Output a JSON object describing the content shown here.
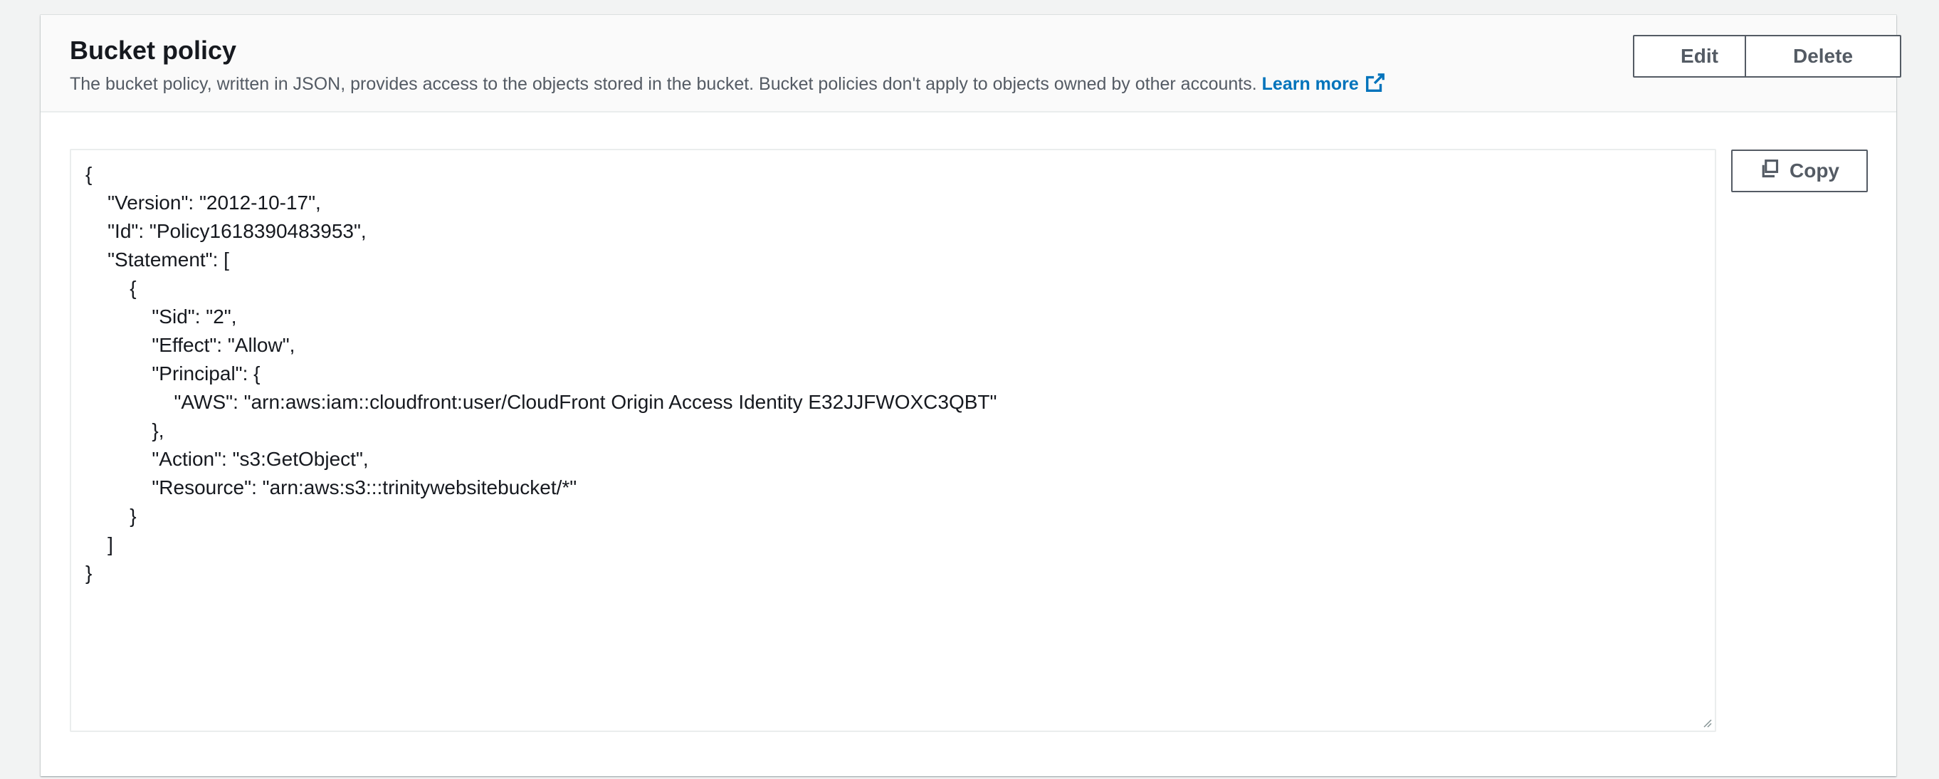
{
  "header": {
    "title": "Bucket policy",
    "description": "The bucket policy, written in JSON, provides access to the objects stored in the bucket. Bucket policies don't apply to objects owned by other accounts.",
    "learn_more": "Learn more"
  },
  "actions": {
    "edit": "Edit",
    "delete": "Delete",
    "copy": "Copy"
  },
  "policy": {
    "text": "{\n    \"Version\": \"2012-10-17\",\n    \"Id\": \"Policy1618390483953\",\n    \"Statement\": [\n        {\n            \"Sid\": \"2\",\n            \"Effect\": \"Allow\",\n            \"Principal\": {\n                \"AWS\": \"arn:aws:iam::cloudfront:user/CloudFront Origin Access Identity E32JJFWOXC3QBT\"\n            },\n            \"Action\": \"s3:GetObject\",\n            \"Resource\": \"arn:aws:s3:::trinitywebsitebucket/*\"\n        }\n    ]\n}"
  },
  "icons": {
    "external_link": "external-link-icon",
    "copy": "copy-icon",
    "resize": "resize-grip-icon"
  },
  "colors": {
    "link": "#0073bb",
    "button_border": "#545b64",
    "header_bg": "#fafafa"
  }
}
